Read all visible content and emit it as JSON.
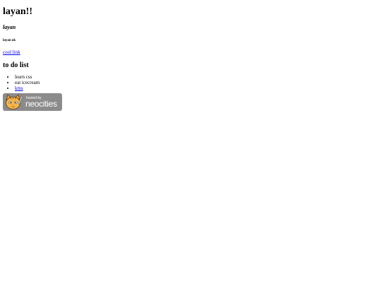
{
  "page": {
    "title": "layan!!",
    "subtitle": "layan",
    "small_note": "layan ok",
    "link": {
      "label": "cool link"
    },
    "todo": {
      "heading": "to do list",
      "items": [
        {
          "text": "learn css",
          "is_link": false
        },
        {
          "text": "eat icecream",
          "is_link": false
        },
        {
          "text": "kms",
          "is_link": true
        }
      ]
    }
  },
  "badge": {
    "hosted_text": "hosted by",
    "brand_text": "neocities",
    "icon": "neocities-cat-icon",
    "bg_color": "#8b8b8b"
  }
}
